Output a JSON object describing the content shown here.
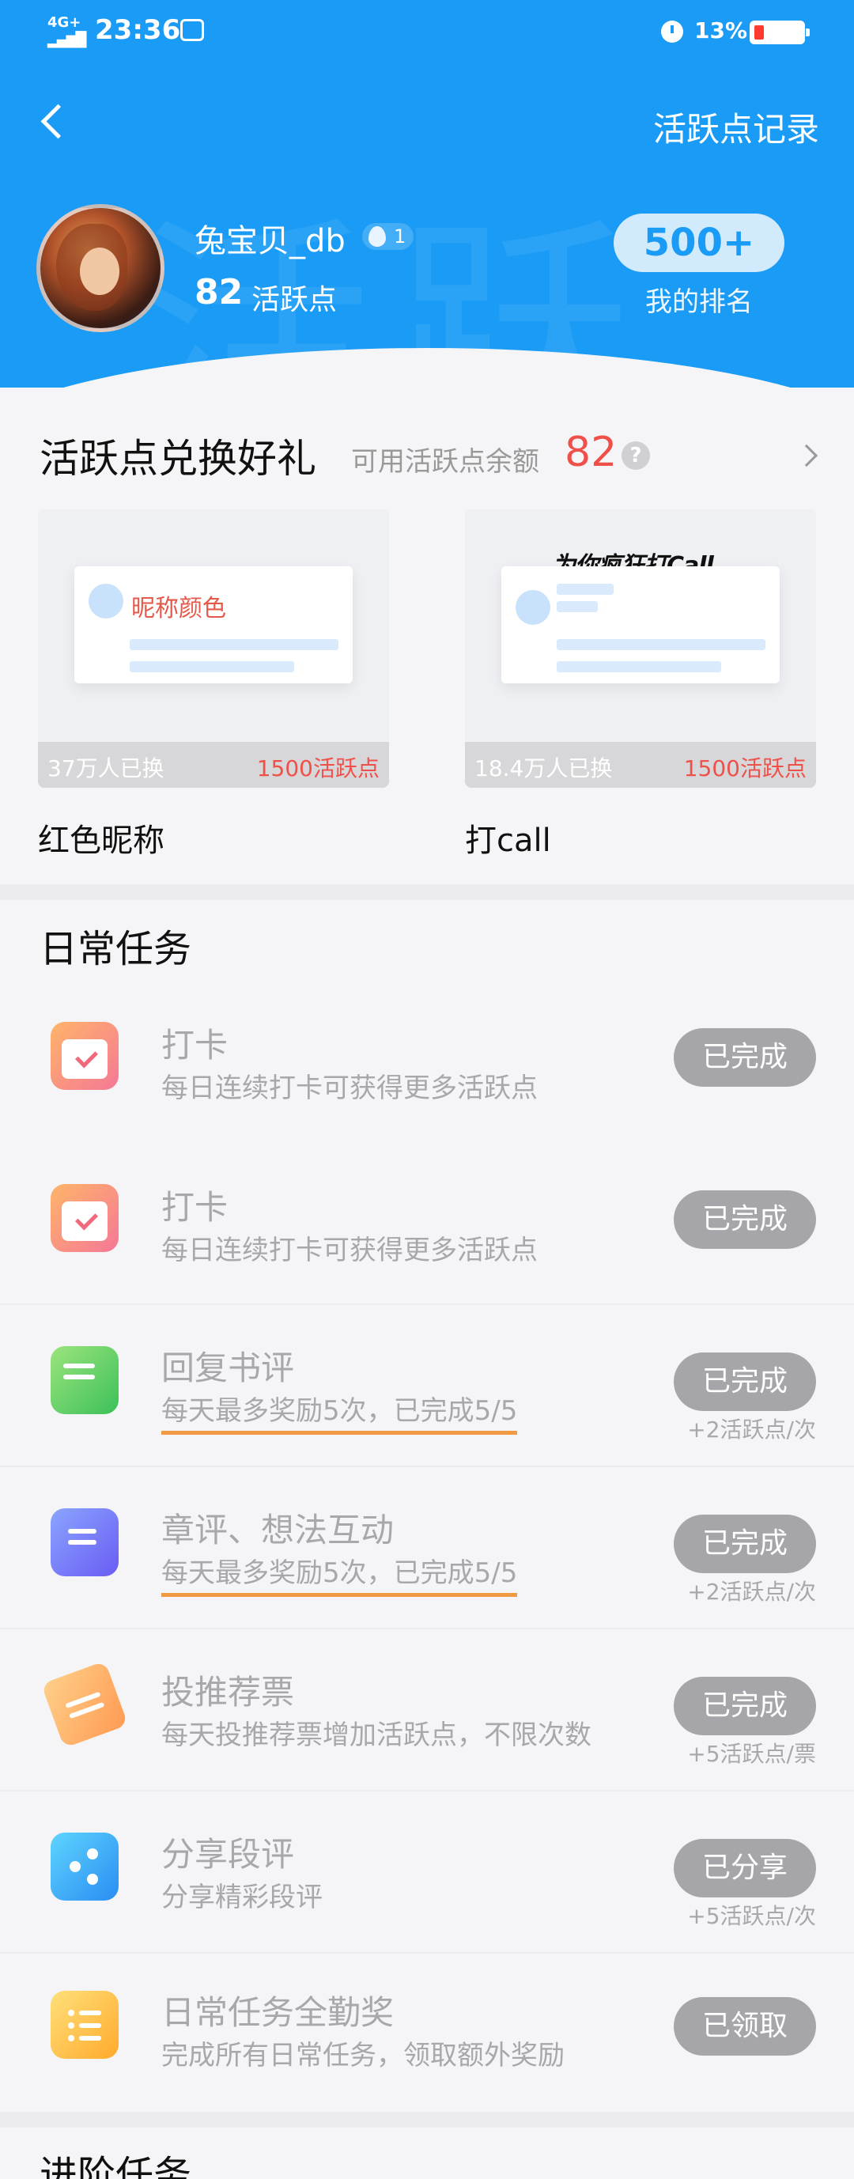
{
  "status_bar": {
    "network": "4G+",
    "signal": "▂▄▆█",
    "time": "23:36",
    "battery": "13%"
  },
  "header": {
    "record_link": "活跃点记录",
    "watermark": "活跃",
    "username": "兔宝贝_db",
    "level": "1",
    "points": "82",
    "points_label": "活跃点",
    "rank_value": "500+",
    "rank_label": "我的排名"
  },
  "exchange": {
    "title": "活跃点兑换好礼",
    "balance_label": "可用活跃点余额",
    "balance_value": "82",
    "help": "?",
    "gifts": [
      {
        "name": "红色昵称",
        "preview_text": "昵称颜色",
        "count": "37万人已换",
        "price": "1500活跃点"
      },
      {
        "name": "打call",
        "preview_text": "为你疯狂打Call",
        "count": "18.4万人已换",
        "price": "1500活跃点"
      }
    ]
  },
  "daily": {
    "title": "日常任务",
    "tasks": [
      {
        "icon": "calendar-check-icon",
        "title": "打卡",
        "sub": "每日连续打卡可获得更多活跃点",
        "button": "已完成",
        "reward": ""
      },
      {
        "icon": "calendar-check-icon",
        "title": "打卡",
        "sub": "每日连续打卡可获得更多活跃点",
        "button": "已完成",
        "reward": ""
      },
      {
        "icon": "chat-bubble-icon",
        "title": "回复书评",
        "sub": "每天最多奖励5次，已完成5/5",
        "button": "已完成",
        "reward": "+2活跃点/次"
      },
      {
        "icon": "note-icon",
        "title": "章评、想法互动",
        "sub": "每天最多奖励5次，已完成5/5",
        "button": "已完成",
        "reward": "+2活跃点/次"
      },
      {
        "icon": "ticket-icon",
        "title": "投推荐票",
        "sub": "每天投推荐票增加活跃点，不限次数",
        "button": "已完成",
        "reward": "+5活跃点/票"
      },
      {
        "icon": "share-icon",
        "title": "分享段评",
        "sub": "分享精彩段评",
        "button": "已分享",
        "reward": "+5活跃点/次"
      },
      {
        "icon": "list-icon",
        "title": "日常任务全勤奖",
        "sub": "完成所有日常任务，领取额外奖励",
        "button": "已领取",
        "reward": ""
      }
    ]
  },
  "advanced": {
    "title": "进阶任务"
  },
  "colors": {
    "header_blue": "#1a9bf5",
    "accent_red": "#f0504a",
    "button_gray": "#a6a6aa",
    "underline_orange": "#f09a44"
  }
}
